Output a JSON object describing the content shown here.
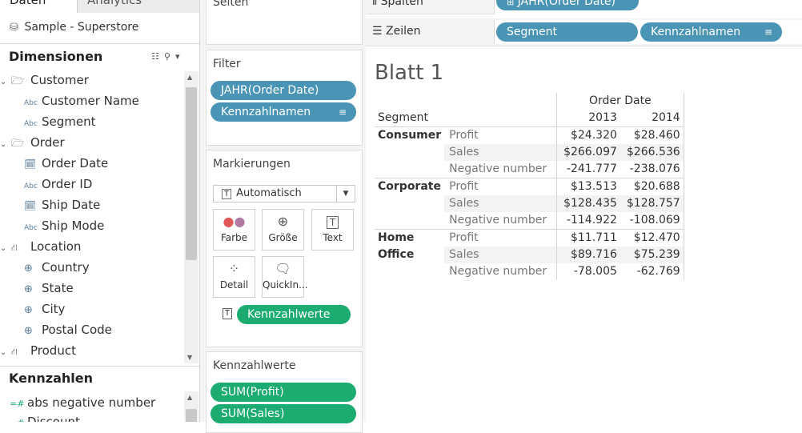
{
  "left_pane": {
    "tab_data": "Daten",
    "tab_analytics": "Analytics",
    "datasource": "Sample - Superstore",
    "dimensions_title": "Dimensionen",
    "dimension_rows": [
      {
        "kind": "folder",
        "label": "Customer"
      },
      {
        "kind": "abc",
        "label": "Customer Name"
      },
      {
        "kind": "abc",
        "label": "Segment"
      },
      {
        "kind": "folder",
        "label": "Order"
      },
      {
        "kind": "date",
        "label": "Order Date"
      },
      {
        "kind": "abc",
        "label": "Order ID"
      },
      {
        "kind": "date",
        "label": "Ship Date"
      },
      {
        "kind": "abc",
        "label": "Ship Mode"
      },
      {
        "kind": "hier",
        "label": "Location"
      },
      {
        "kind": "geo",
        "label": "Country"
      },
      {
        "kind": "geo",
        "label": "State"
      },
      {
        "kind": "geo",
        "label": "City"
      },
      {
        "kind": "geo",
        "label": "Postal Code"
      },
      {
        "kind": "hier",
        "label": "Product"
      }
    ],
    "measures_title": "Kennzahlen",
    "measure_rows": [
      {
        "label": "abs negative number"
      },
      {
        "label": "Discount"
      }
    ],
    "abc_glyph": "Abc",
    "hash_glyph": "=#"
  },
  "middle": {
    "pages_title": "Seiten",
    "filter_title": "Filter",
    "filter_pills": [
      "JAHR(Order Date)",
      "Kennzahlnamen"
    ],
    "marks_title": "Markierungen",
    "marks_type": "Automatisch",
    "mark_buttons": [
      "Farbe",
      "Größe",
      "Text",
      "Detail",
      "QuickIn..."
    ],
    "text_pill": "Kennzahlwerte",
    "values_title": "Kennzahlwerte",
    "value_pills": [
      "SUM(Profit)",
      "SUM(Sales)"
    ]
  },
  "shelves": {
    "columns_label": "Spalten",
    "columns_pill": "JAHR(Order Date)",
    "rows_label": "Zeilen",
    "rows_pills": [
      "Segment",
      "Kennzahlnamen"
    ]
  },
  "sheet": {
    "title": "Blatt 1",
    "column_field": "Order Date",
    "row_field": "Segment",
    "years": [
      "2013",
      "2014"
    ],
    "groups": [
      {
        "segment": [
          "Consumer"
        ],
        "rows": [
          {
            "measure": "Profit",
            "v": [
              "$24.320",
              "$28.460"
            ]
          },
          {
            "measure": "Sales",
            "v": [
              "$266.097",
              "$266.536"
            ]
          },
          {
            "measure": "Negative number",
            "v": [
              "-241.777",
              "-238.076"
            ]
          }
        ]
      },
      {
        "segment": [
          "Corporate"
        ],
        "rows": [
          {
            "measure": "Profit",
            "v": [
              "$13.513",
              "$20.688"
            ]
          },
          {
            "measure": "Sales",
            "v": [
              "$128.435",
              "$128.757"
            ]
          },
          {
            "measure": "Negative number",
            "v": [
              "-114.922",
              "-108.069"
            ]
          }
        ]
      },
      {
        "segment": [
          "Home",
          "Office"
        ],
        "rows": [
          {
            "measure": "Profit",
            "v": [
              "$11.711",
              "$12.470"
            ]
          },
          {
            "measure": "Sales",
            "v": [
              "$89.716",
              "$75.239"
            ]
          },
          {
            "measure": "Negative number",
            "v": [
              "-78.005",
              "-62.769"
            ]
          }
        ]
      }
    ]
  },
  "colors": {
    "blue_pill": "#4a95b5",
    "green_pill": "#1dac70"
  }
}
